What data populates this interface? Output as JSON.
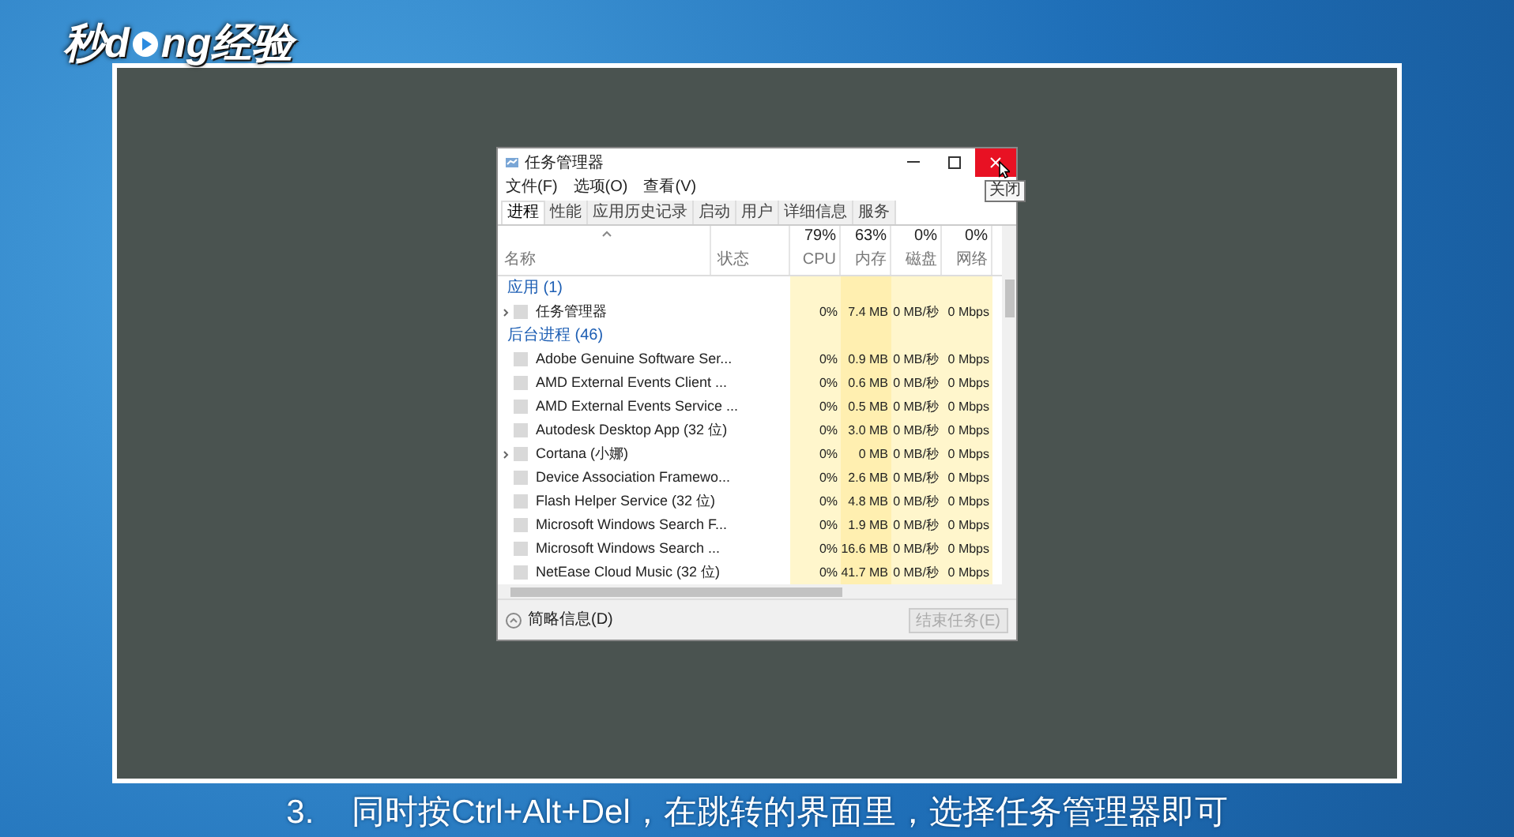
{
  "logo": {
    "text_before": "秒d",
    "text_after": "ng经验"
  },
  "window": {
    "title": "任务管理器",
    "close_tooltip": "关闭",
    "menu": [
      "文件(F)",
      "选项(O)",
      "查看(V)"
    ],
    "tabs": [
      {
        "label": "进程",
        "selected": true
      },
      {
        "label": "性能",
        "selected": false
      },
      {
        "label": "应用历史记录",
        "selected": false
      },
      {
        "label": "启动",
        "selected": false
      },
      {
        "label": "用户",
        "selected": false
      },
      {
        "label": "详细信息",
        "selected": false
      },
      {
        "label": "服务",
        "selected": false
      }
    ],
    "columns": [
      {
        "label": "名称"
      },
      {
        "label": "状态"
      },
      {
        "percent": "79%",
        "label": "CPU"
      },
      {
        "percent": "63%",
        "label": "内存"
      },
      {
        "percent": "0%",
        "label": "磁盘"
      },
      {
        "percent": "0%",
        "label": "网络"
      }
    ],
    "rows": [
      {
        "kind": "group",
        "name": "应用 (1)"
      },
      {
        "kind": "process",
        "expandable": true,
        "name": "任务管理器",
        "cpu": "0%",
        "memory": "7.4 MB",
        "disk": "0 MB/秒",
        "network": "0 Mbps"
      },
      {
        "kind": "group",
        "name": "后台进程 (46)"
      },
      {
        "kind": "process",
        "expandable": false,
        "name": "Adobe Genuine Software Ser...",
        "cpu": "0%",
        "memory": "0.9 MB",
        "disk": "0 MB/秒",
        "network": "0 Mbps"
      },
      {
        "kind": "process",
        "expandable": false,
        "name": "AMD External Events Client ...",
        "cpu": "0%",
        "memory": "0.6 MB",
        "disk": "0 MB/秒",
        "network": "0 Mbps"
      },
      {
        "kind": "process",
        "expandable": false,
        "name": "AMD External Events Service ...",
        "cpu": "0%",
        "memory": "0.5 MB",
        "disk": "0 MB/秒",
        "network": "0 Mbps"
      },
      {
        "kind": "process",
        "expandable": false,
        "name": "Autodesk Desktop App (32 位)",
        "cpu": "0%",
        "memory": "3.0 MB",
        "disk": "0 MB/秒",
        "network": "0 Mbps"
      },
      {
        "kind": "process",
        "expandable": true,
        "name": "Cortana (小娜)",
        "cpu": "0%",
        "memory": "0 MB",
        "disk": "0 MB/秒",
        "network": "0 Mbps"
      },
      {
        "kind": "process",
        "expandable": false,
        "name": "Device Association Framewo...",
        "cpu": "0%",
        "memory": "2.6 MB",
        "disk": "0 MB/秒",
        "network": "0 Mbps"
      },
      {
        "kind": "process",
        "expandable": false,
        "name": "Flash Helper Service (32 位)",
        "cpu": "0%",
        "memory": "4.8 MB",
        "disk": "0 MB/秒",
        "network": "0 Mbps"
      },
      {
        "kind": "process",
        "expandable": false,
        "name": "Microsoft Windows Search F...",
        "cpu": "0%",
        "memory": "1.9 MB",
        "disk": "0 MB/秒",
        "network": "0 Mbps"
      },
      {
        "kind": "process",
        "expandable": false,
        "name": "Microsoft Windows Search ...",
        "cpu": "0%",
        "memory": "16.6 MB",
        "disk": "0 MB/秒",
        "network": "0 Mbps"
      },
      {
        "kind": "process",
        "expandable": false,
        "name": "NetEase Cloud Music (32 位)",
        "cpu": "0%",
        "memory": "41.7 MB",
        "disk": "0 MB/秒",
        "network": "0 Mbps"
      }
    ],
    "footer": {
      "details": "简略信息(D)",
      "end_task": {
        "label": "结束任务(E)",
        "disabled": true
      }
    }
  },
  "caption": {
    "step": "3.",
    "text": "同时按Ctrl+Alt+Del，在跳转的界面里，选择任务管理器即可"
  }
}
